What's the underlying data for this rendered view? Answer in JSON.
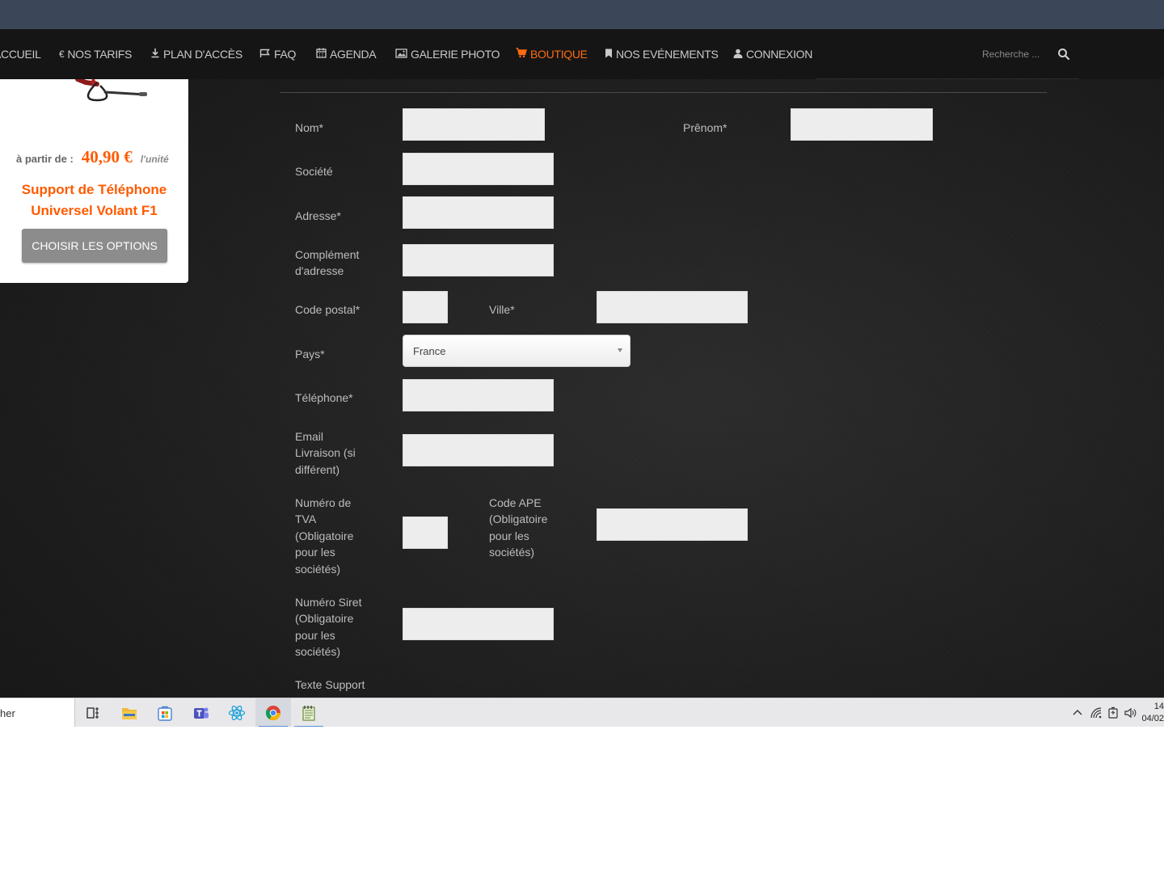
{
  "nav": {
    "items": [
      {
        "label": "ACCUEIL",
        "icon": "home-icon"
      },
      {
        "label": "NOS TARIFS",
        "icon": "euro-icon"
      },
      {
        "label": "PLAN D'ACCÈS",
        "icon": "download-icon"
      },
      {
        "label": "FAQ",
        "icon": "flag-icon"
      },
      {
        "label": "AGENDA",
        "icon": "calendar-icon"
      },
      {
        "label": "GALERIE PHOTO",
        "icon": "image-icon"
      },
      {
        "label": "BOUTIQUE",
        "icon": "cart-icon",
        "active": true
      },
      {
        "label": "NOS EVÉNEMENTS",
        "icon": "bookmark-icon"
      },
      {
        "label": "CONNEXION",
        "icon": "user-icon"
      }
    ],
    "search_placeholder": "Recherche ..."
  },
  "product": {
    "price_prefix": "à partir de :",
    "price": "40,90 €",
    "price_unit": "l'unité",
    "title_line1": "Support de Téléphone",
    "title_line2": "Universel Volant F1",
    "button_label": "CHOISIR LES OPTIONS"
  },
  "form": {
    "nom_label": "Nom*",
    "prenom_label": "Prênom*",
    "societe_label": "Société",
    "adresse_label": "Adresse*",
    "complement_label_1": "Complément",
    "complement_label_2": "d'adresse",
    "code_postal_label": "Code postal*",
    "ville_label": "Ville*",
    "pays_label": "Pays*",
    "pays_value": "France",
    "telephone_label": "Téléphone*",
    "email_label_1": "Email",
    "email_label_2": "Livraison (si",
    "email_label_3": "différent)",
    "tva_label_1": "Numéro de",
    "tva_label_2": "TVA",
    "tva_label_3": "(Obligatoire",
    "tva_label_4": "pour les",
    "tva_label_5": "sociétés)",
    "ape_label_1": "Code APE",
    "ape_label_2": "(Obligatoire",
    "ape_label_3": "pour les",
    "ape_label_4": "sociétés)",
    "siret_label_1": "Numéro Siret",
    "siret_label_2": "(Obligatoire",
    "siret_label_3": "pour les",
    "siret_label_4": "sociétés)",
    "texte_support_label": "Texte Support"
  },
  "taskbar": {
    "search_text": "her",
    "clock_time": "14",
    "clock_date": "04/02",
    "apps": [
      "task-view-icon",
      "file-explorer-icon",
      "store-icon",
      "teams-icon",
      "react-icon",
      "chrome-icon",
      "notepad-icon"
    ]
  },
  "colors": {
    "accent": "#ff6a13",
    "price": "#ff5a00",
    "button": "#8c8c8c",
    "navbar": "#151515",
    "browser_strip": "#3b4658"
  }
}
